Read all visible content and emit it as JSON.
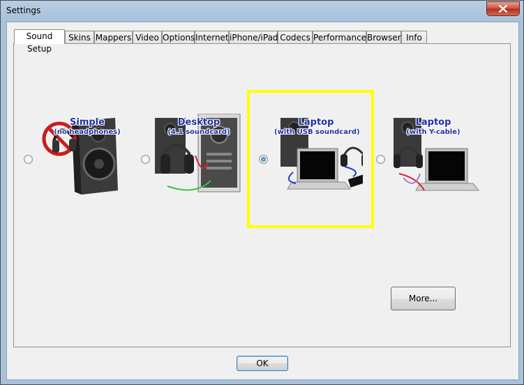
{
  "window": {
    "title": "Settings"
  },
  "tabs": [
    {
      "label": "Sound Setup",
      "active": true
    },
    {
      "label": "Skins"
    },
    {
      "label": "Mappers"
    },
    {
      "label": "Video"
    },
    {
      "label": "Options"
    },
    {
      "label": "Internet"
    },
    {
      "label": "iPhone/iPad"
    },
    {
      "label": "Codecs"
    },
    {
      "label": "Performances"
    },
    {
      "label": "Browser"
    },
    {
      "label": "Info"
    }
  ],
  "options": [
    {
      "title": "Simple",
      "subtitle": "(no headphones)",
      "checked": false
    },
    {
      "title": "Desktop",
      "subtitle": "(4.1 soundcard)",
      "checked": false
    },
    {
      "title": "Laptop",
      "subtitle": "(with USB soundcard)",
      "checked": true
    },
    {
      "title": "Laptop",
      "subtitle": "(with Y-cable)",
      "checked": false
    }
  ],
  "buttons": {
    "more": "More...",
    "ok": "OK"
  },
  "colors": {
    "highlight": "#ffff00",
    "label": "#1f2fa6"
  }
}
